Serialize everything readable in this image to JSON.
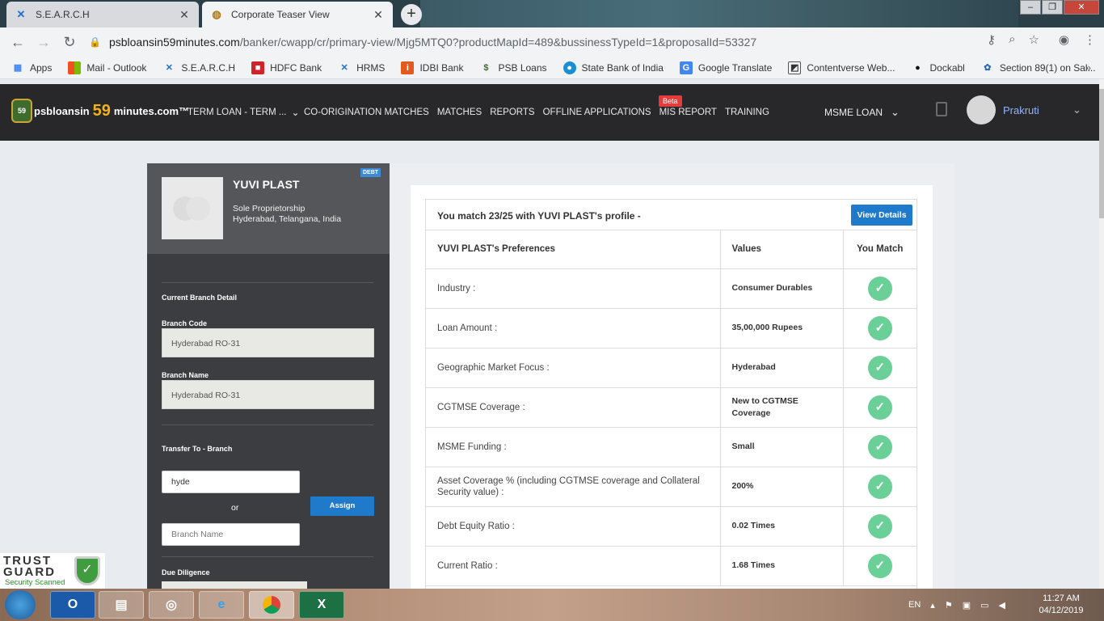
{
  "browser": {
    "tabs": [
      {
        "title": "S.E.A.R.C.H",
        "icon": "search-logo-icon"
      },
      {
        "title": "Corporate Teaser View",
        "icon": "globe-icon"
      }
    ],
    "url_domain": "psbloansin59minutes.com",
    "url_path": "/banker/cwapp/cr/primary-view/Mjg5MTQ0?productMapId=489&bussinessTypeId=1&proposalId=53327",
    "bookmarks": [
      {
        "label": "Apps",
        "icon": "apps-grid-icon"
      },
      {
        "label": "Mail - Outlook",
        "icon": "windows-icon"
      },
      {
        "label": "S.E.A.R.C.H",
        "icon": "search-logo-icon"
      },
      {
        "label": "HDFC Bank",
        "icon": "hdfc-icon"
      },
      {
        "label": "HRMS",
        "icon": "hrms-icon"
      },
      {
        "label": "IDBI Bank",
        "icon": "idbi-icon"
      },
      {
        "label": "PSB Loans",
        "icon": "psb-icon"
      },
      {
        "label": "State Bank of India",
        "icon": "sbi-icon"
      },
      {
        "label": "Google Translate",
        "icon": "translate-icon"
      },
      {
        "label": "Contentverse Web...",
        "icon": "contentverse-icon"
      },
      {
        "label": "Dockabl",
        "icon": "dockabl-icon"
      },
      {
        "label": "Section 89(1) on Sal...",
        "icon": "section-icon"
      }
    ]
  },
  "header": {
    "logo_badge": "59",
    "logo_text_1": "psbloansin",
    "logo_text_2": "59",
    "logo_text_3": "minutes.com™",
    "term_loan": "TERM LOAN - TERM ...",
    "nav_items": [
      "CO-ORIGINATION MATCHES",
      "MATCHES",
      "REPORTS",
      "OFFLINE APPLICATIONS",
      "MIS REPORT",
      "TRAINING"
    ],
    "beta": "Beta",
    "msme": "MSME LOAN",
    "user": "Prakruti"
  },
  "company": {
    "name": "YUVI PLAST",
    "type": "Sole Proprietorship",
    "location": "Hyderabad, Telangana, India",
    "badge": "DEBT"
  },
  "branch": {
    "section_title": "Current Branch Detail",
    "code_label": "Branch Code",
    "code_value": "Hyderabad RO-31",
    "name_label": "Branch Name",
    "name_value": "Hyderabad RO-31",
    "transfer_label": "Transfer To - Branch",
    "transfer_input": "hyde",
    "or": "or",
    "assign": "Assign",
    "name_placeholder": "Branch Name",
    "due_diligence": "Due Diligence"
  },
  "match": {
    "title": "You match 23/25 with YUVI PLAST's profile -",
    "view_details": "View Details",
    "columns": [
      "YUVI PLAST's Preferences",
      "Values",
      "You Match"
    ],
    "rows": [
      {
        "pref": "Industry :",
        "value": "Consumer Durables",
        "match": "✓"
      },
      {
        "pref": "Loan Amount :",
        "value": "35,00,000 Rupees",
        "match": "✓"
      },
      {
        "pref": "Geographic Market Focus :",
        "value": "Hyderabad",
        "match": "✓"
      },
      {
        "pref": "CGTMSE Coverage :",
        "value": "New to CGTMSE Coverage",
        "match": "✓"
      },
      {
        "pref": "MSME Funding :",
        "value": "Small",
        "match": "✓"
      },
      {
        "pref": "Asset Coverage % (including CGTMSE coverage and Collateral Security value) :",
        "value": "200%",
        "match": "✓"
      },
      {
        "pref": "Debt Equity Ratio :",
        "value": "0.02 Times",
        "match": "✓"
      },
      {
        "pref": "Current Ratio :",
        "value": "1.68 Times",
        "match": "✓"
      }
    ]
  },
  "trustguard": {
    "line1": "TRUST",
    "line2": "GUARD",
    "line3": "Security Scanned"
  },
  "taskbar": {
    "lang": "EN",
    "time": "11:27 AM",
    "date": "04/12/2019"
  }
}
